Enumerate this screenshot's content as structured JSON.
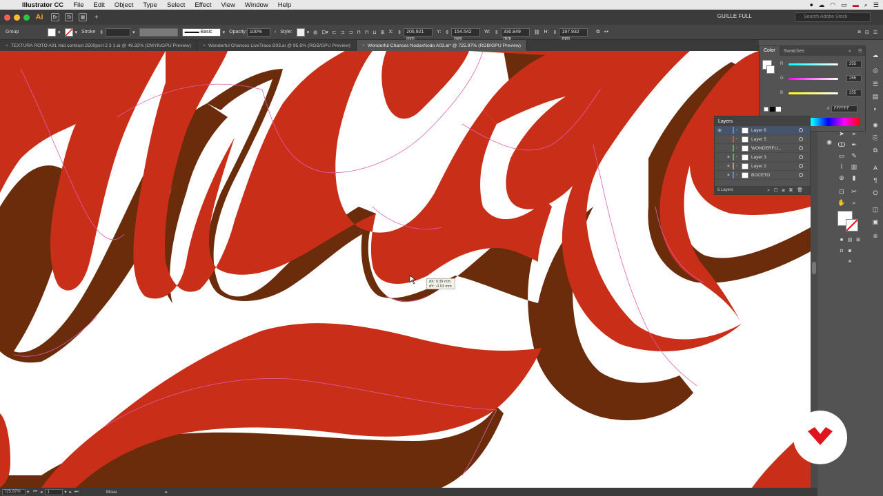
{
  "menubar": {
    "app": "Illustrator CC",
    "items": [
      "File",
      "Edit",
      "Object",
      "Type",
      "Select",
      "Effect",
      "View",
      "Window",
      "Help"
    ]
  },
  "appbar": {
    "workspace": "GUILLE FULL",
    "search_placeholder": "Search Adobe Stock"
  },
  "control": {
    "selection": "Group",
    "stroke_label": "Stroke",
    "brush": "Basic",
    "opacity_label": "Opacity:",
    "opacity": "100%",
    "style_label": "Style:",
    "x_label": "X:",
    "x": "205.921 mm",
    "y_label": "Y:",
    "y": "154.542 mm",
    "w_label": "W:",
    "w": "330.849 mm",
    "h_label": "H:",
    "h": "197.932 mm"
  },
  "tabs": [
    {
      "label": "TEXTURA ROTO A01 mid contrast 2500pxH 2 3 1.ai @ 49.32% (CMYK/GPU Preview)"
    },
    {
      "label": "Wonderful Chances LiveTrace B03.ai @ 95.6% (RGB/GPU Preview)"
    },
    {
      "label": "Wonderful Chances NodoxNodo A03.ai* @ 725.97% (RGB/GPU Preview)"
    }
  ],
  "tooltip": {
    "dx": "dX: 0.39 mm",
    "dy": "dY: -0.53 mm"
  },
  "color": {
    "tab_color": "Color",
    "tab_swatches": "Swatches",
    "r_label": "R",
    "g_label": "G",
    "b_label": "B",
    "r": "255",
    "g": "255",
    "b": "255",
    "hex_label": "#",
    "hex": "FFFFFF"
  },
  "layers": {
    "title": "Layers",
    "items": [
      {
        "name": "Layer 6",
        "color": "#4f8cf5",
        "locked": false,
        "selected": true
      },
      {
        "name": "Layer 5",
        "color": "#e84848",
        "locked": false,
        "selected": false
      },
      {
        "name": "WONDERFU...",
        "color": "#48c048",
        "locked": false,
        "selected": false
      },
      {
        "name": "Layer 3",
        "color": "#48c048",
        "locked": true,
        "selected": false
      },
      {
        "name": "Layer 2",
        "color": "#e89048",
        "locked": true,
        "selected": false
      },
      {
        "name": "BOCETO",
        "color": "#4f8cf5",
        "locked": true,
        "selected": false
      }
    ],
    "count": "6 Layers"
  },
  "status": {
    "zoom": "725.97%",
    "artboard": "1",
    "tool": "Move"
  },
  "colors": {
    "red": "#c92f18",
    "brown": "#6b2c0c",
    "guide": "#e05fb0",
    "canvas": "#ffffff"
  }
}
